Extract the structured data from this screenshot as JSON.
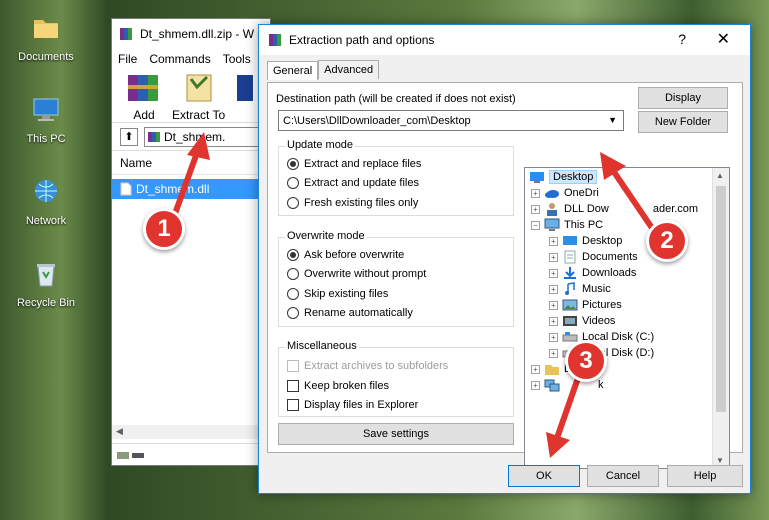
{
  "desktop": {
    "icons": [
      {
        "label": "Documents",
        "icon": "folder-icon"
      },
      {
        "label": "This PC",
        "icon": "computer-icon"
      },
      {
        "label": "Network",
        "icon": "network-icon"
      },
      {
        "label": "Recycle Bin",
        "icon": "recycle-bin-icon"
      }
    ]
  },
  "winrar": {
    "title": "Dt_shmem.dll.zip - W",
    "menu": [
      "File",
      "Commands",
      "Tools"
    ],
    "tools": [
      {
        "label": "Add"
      },
      {
        "label": "Extract To"
      }
    ],
    "address": "Dt_shmem.",
    "column_name": "Name",
    "file": "Dt_shmem.dll"
  },
  "dialog": {
    "title": "Extraction path and options",
    "help": "?",
    "close": "✕",
    "tabs": [
      "General",
      "Advanced"
    ],
    "dest_label": "Destination path (will be created if does not exist)",
    "dest_value": "C:\\Users\\DllDownloader_com\\Desktop",
    "display_btn": "Display",
    "new_folder_btn": "New Folder",
    "update_mode": {
      "title": "Update mode",
      "options": [
        "Extract and replace files",
        "Extract and update files",
        "Fresh existing files only"
      ],
      "selected": 0
    },
    "overwrite_mode": {
      "title": "Overwrite mode",
      "options": [
        "Ask before overwrite",
        "Overwrite without prompt",
        "Skip existing files",
        "Rename automatically"
      ],
      "selected": 0
    },
    "misc": {
      "title": "Miscellaneous",
      "options": [
        "Extract archives to subfolders",
        "Keep broken files",
        "Display files in Explorer"
      ]
    },
    "save_settings": "Save settings",
    "tree": [
      "Desktop",
      "OneDrive",
      "DLL Downloader.com",
      "This PC",
      "Desktop",
      "Documents",
      "Downloads",
      "Music",
      "Pictures",
      "Videos",
      "Local Disk (C:)",
      "Local Disk (D:)",
      "Libraries",
      "Network"
    ],
    "tree_partial": {
      "onedrive": "OneDri",
      "dll": "DLL Dow",
      "dll_tail": "ader.com",
      "libraries": "Li",
      "libraries_tail": "ies",
      "network": "k"
    },
    "ok": "OK",
    "cancel": "Cancel",
    "help_btn": "Help"
  },
  "callouts": [
    "1",
    "2",
    "3"
  ],
  "colors": {
    "callout": "#e0342f",
    "accent": "#0078d7",
    "selection": "#3399ff"
  }
}
